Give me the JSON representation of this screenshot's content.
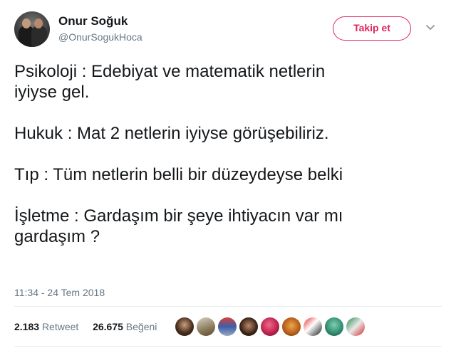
{
  "user": {
    "name": "Onur Soğuk",
    "handle": "@OnurSogukHoca"
  },
  "header": {
    "follow_label": "Takip et",
    "menu_icon": "chevron-down-icon"
  },
  "tweet": {
    "lines": [
      "Psikoloji : Edebiyat ve matematik netlerin",
      "iyiyse gel.",
      "",
      "Hukuk : Mat 2 netlerin iyiyse görüşebiliriz.",
      "",
      "Tıp : Tüm netlerin belli bir düzeydeyse belki",
      "",
      "İşletme : Gardaşım bir şeye ihtiyacın var mı",
      "gardaşım ?"
    ],
    "timestamp": "11:34 - 24 Tem 2018"
  },
  "stats": {
    "retweets": "2.183",
    "retweet_label": "Retweet",
    "likes": "26.675",
    "like_label": "Beğeni"
  },
  "colors": {
    "follow_accent": "#e0245e",
    "secondary_text": "#657786",
    "primary_text": "#14171a"
  }
}
